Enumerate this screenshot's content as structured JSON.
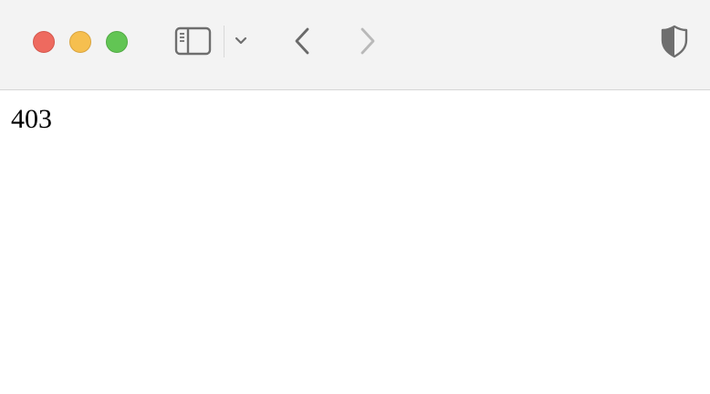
{
  "window": {
    "traffic_lights": {
      "close_color": "#ee6a5f",
      "minimize_color": "#f6bf4f",
      "zoom_color": "#62c554"
    }
  },
  "toolbar": {
    "icons": {
      "sidebar": "sidebar-icon",
      "tab_group_menu": "chevron-down-icon",
      "back": "chevron-left-icon",
      "forward": "chevron-right-icon",
      "privacy": "shield-icon"
    },
    "forward_enabled": false
  },
  "page": {
    "body_text": "403"
  }
}
